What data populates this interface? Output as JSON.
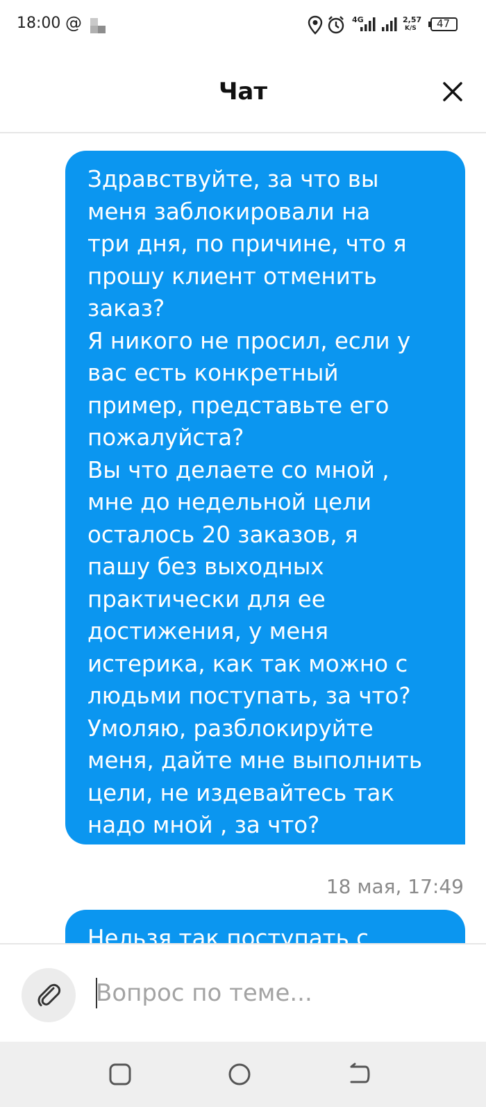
{
  "status_bar": {
    "time": "18:00",
    "at_symbol": "@",
    "network": "4G",
    "speed": "2,57",
    "speed_unit": "K/S",
    "battery": "47",
    "icons": [
      "location-icon",
      "alarm-icon",
      "signal-icon",
      "battery-icon"
    ]
  },
  "header": {
    "title": "Чат",
    "close_icon": "close-icon"
  },
  "messages": [
    {
      "text": "Здравствуйте, за что вы\nменя заблокировали на\nтри дня, по причине, что я\nпрошу клиент отменить\nзаказ?\nЯ никого не просил, если у\nвас есть конкретный\nпример, представьте его\nпожалуйста?\nВы что делаете со мной ,\nмне до недельной цели\nосталось 20 заказов, я\nпашу без выходных\nпрактически для ее\nдостижения, у меня\nистерика, как так можно с\nлюдьми поступать, за что?\nУмоляю, разблокируйте\nменя, дайте мне выполнить\nцели, не издевайтесь так\nнадо мной , за что?",
      "timestamp": "18 мая, 17:49"
    },
    {
      "text": "Нельзя так поступать с"
    }
  ],
  "composer": {
    "placeholder": "Вопрос по теме...",
    "value": "",
    "attach_icon": "paperclip-icon"
  },
  "nav_bar": {
    "buttons": [
      "recent-apps-icon",
      "home-icon",
      "back-icon"
    ]
  },
  "colors": {
    "bubble": "#0b96f0",
    "timestamp": "#8a8a8a",
    "navbar": "#efefef"
  }
}
